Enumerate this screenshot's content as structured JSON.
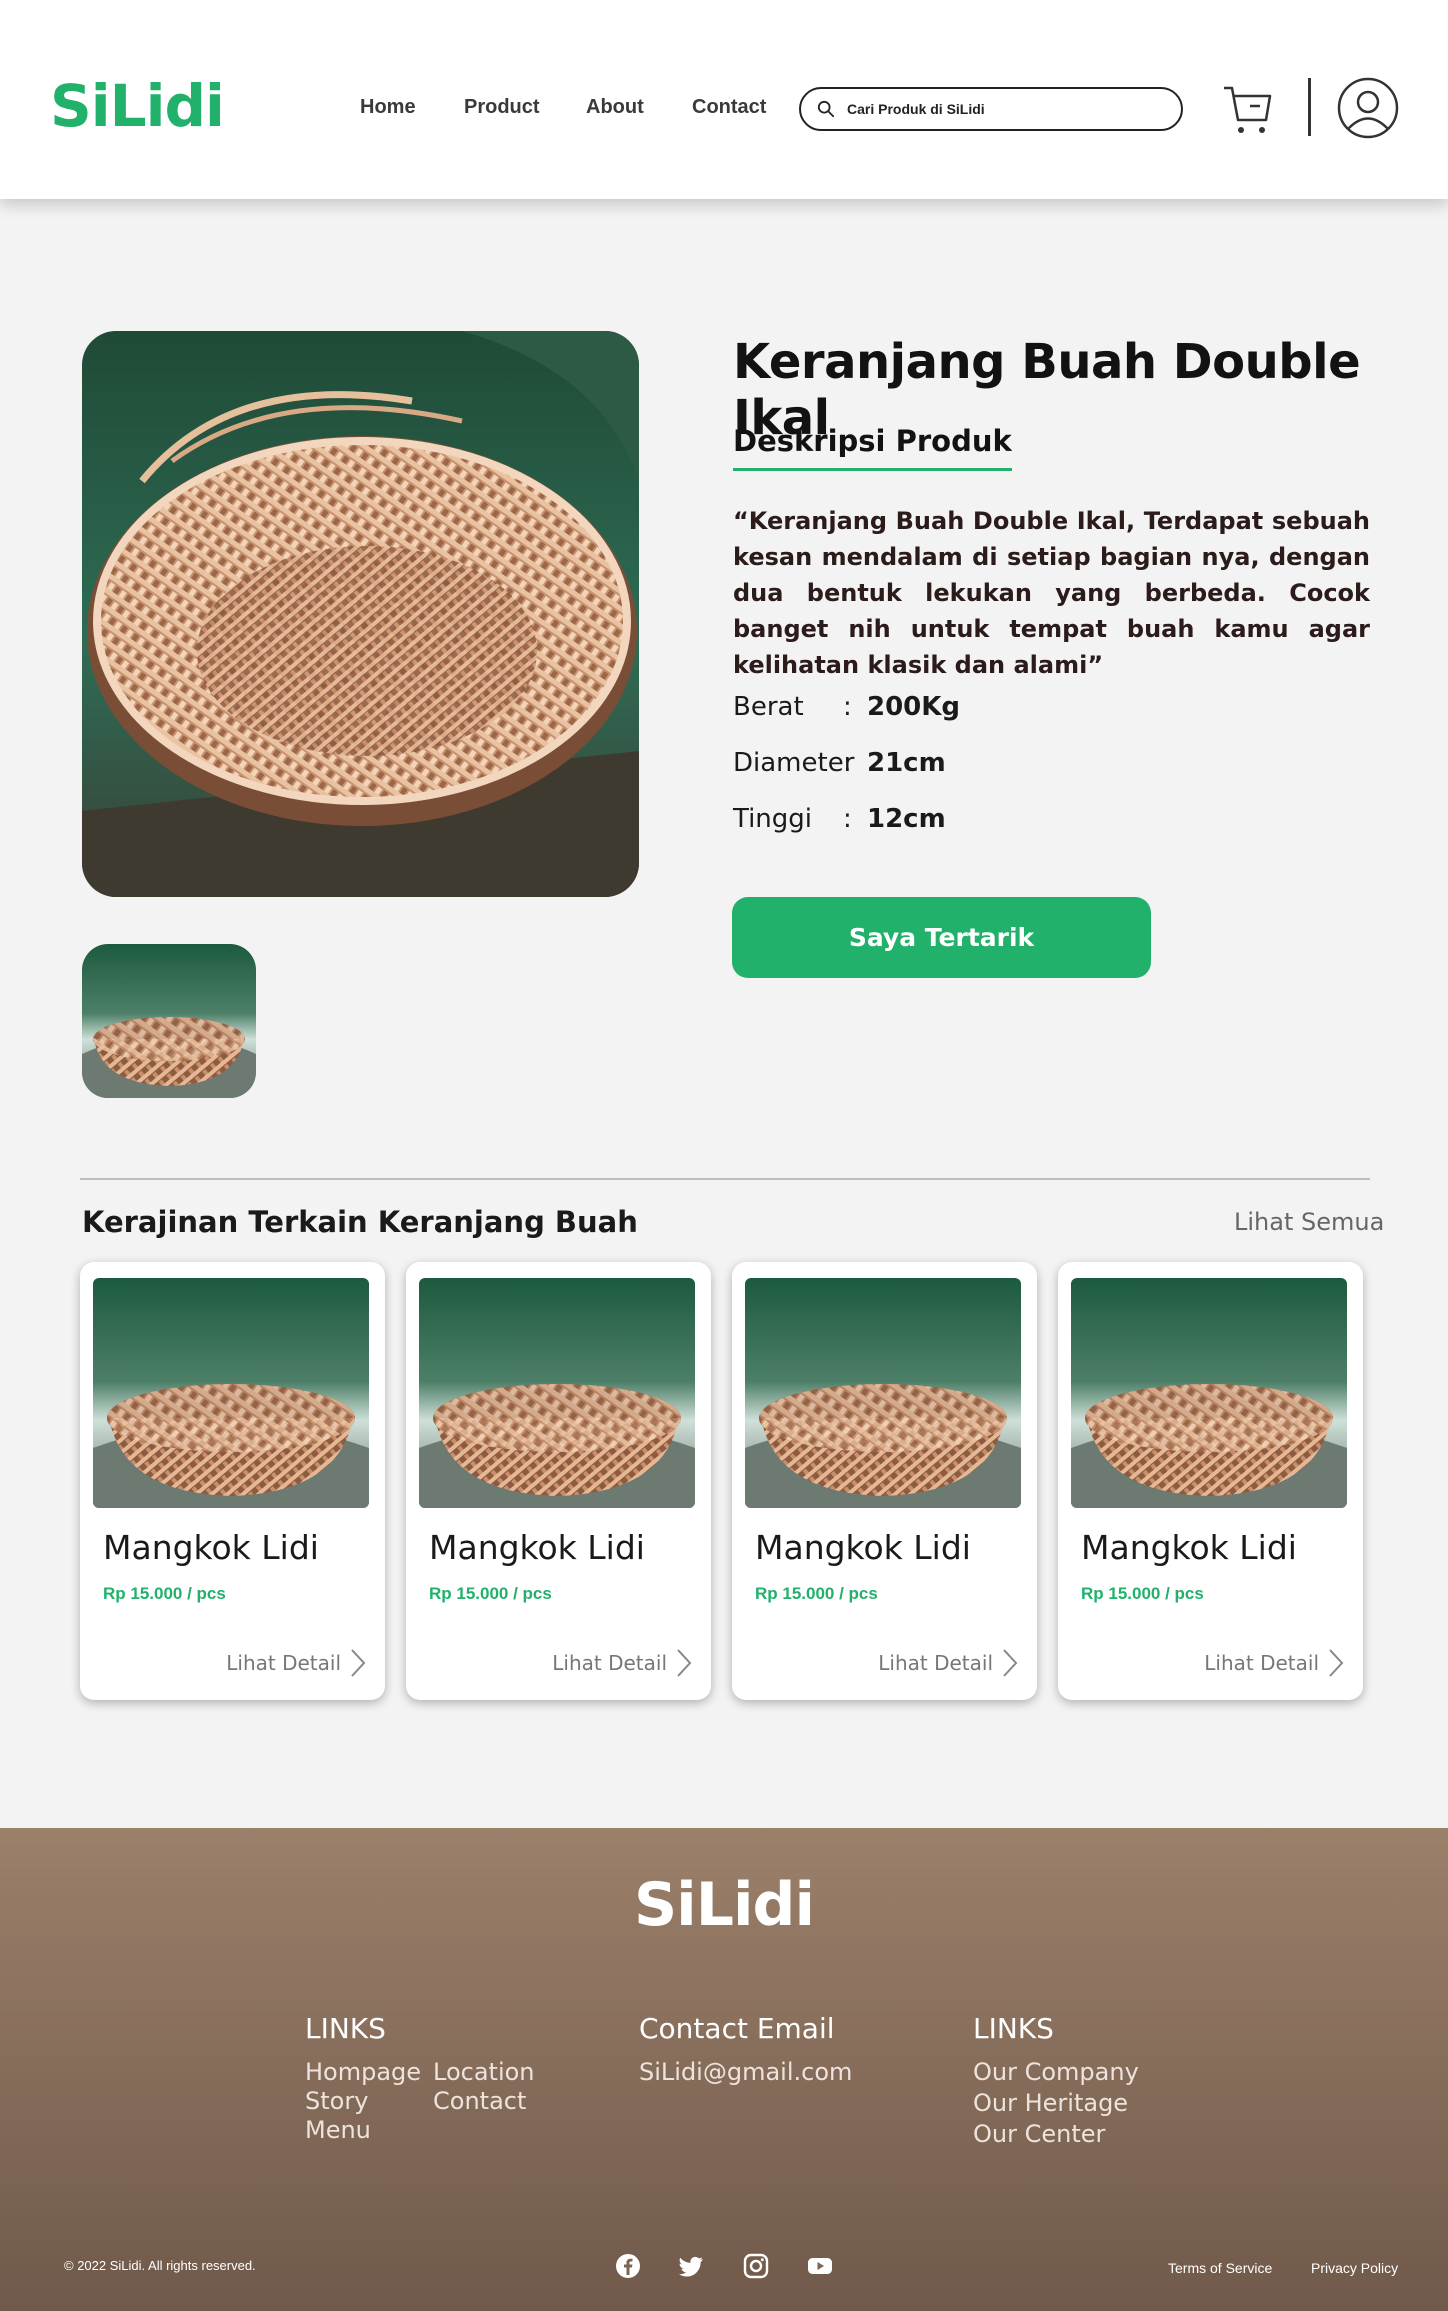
{
  "header": {
    "logo": "SiLidi",
    "nav": {
      "home": "Home",
      "product": "Product",
      "about": "About",
      "contact": "Contact"
    },
    "search_placeholder": "Cari Produk di SiLidi",
    "icons": [
      "search-icon",
      "cart-icon",
      "user-icon"
    ]
  },
  "product": {
    "title": "Keranjang Buah Double Ikal",
    "description_heading": "Deskripsi Produk",
    "description": "“Keranjang Buah Double Ikal, Terdapat sebuah kesan mendalam di setiap bagian nya, dengan dua bentuk lekukan yang berbeda. Cocok banget nih untuk tempat buah kamu agar kelihatan klasik dan alami”",
    "specs": [
      {
        "label": "Berat",
        "sep": ":",
        "value": "200Kg"
      },
      {
        "label": "Diameter",
        "sep": ":",
        "value": "21cm"
      },
      {
        "label": "Tinggi",
        "sep": ":",
        "value": "12cm"
      }
    ],
    "cta": "Saya Tertarik"
  },
  "related": {
    "title": "Kerajinan Terkain Keranjang Buah",
    "see_all": "Lihat Semua",
    "items": [
      {
        "name": "Mangkok Lidi",
        "price": "Rp 15.000 / pcs",
        "detail": "Lihat Detail"
      },
      {
        "name": "Mangkok Lidi",
        "price": "Rp 15.000 / pcs",
        "detail": "Lihat Detail"
      },
      {
        "name": "Mangkok Lidi",
        "price": "Rp 15.000 / pcs",
        "detail": "Lihat Detail"
      },
      {
        "name": "Mangkok Lidi",
        "price": "Rp 15.000 / pcs",
        "detail": "Lihat Detail"
      }
    ]
  },
  "footer": {
    "logo": "SiLidi",
    "links1_heading": "LINKS",
    "links1": [
      "Hompage",
      "Story",
      "Menu",
      "Location",
      "Contact"
    ],
    "contact_heading": "Contact Email",
    "contact_email": "SiLidi@gmail.com",
    "links2_heading": "LINKS",
    "links2": [
      "Our Company",
      "Our Heritage",
      "Our Center"
    ],
    "copyright": "© 2022 SiLidi. All rights reserved.",
    "social_icons": [
      "facebook-icon",
      "twitter-icon",
      "instagram-icon",
      "youtube-icon"
    ],
    "terms": "Terms of Service",
    "privacy": "Privacy Policy"
  },
  "colors": {
    "accent": "#21b16b",
    "footer_top": "#9b806a",
    "footer_bottom": "#70594a",
    "background": "#f3f3f3"
  }
}
